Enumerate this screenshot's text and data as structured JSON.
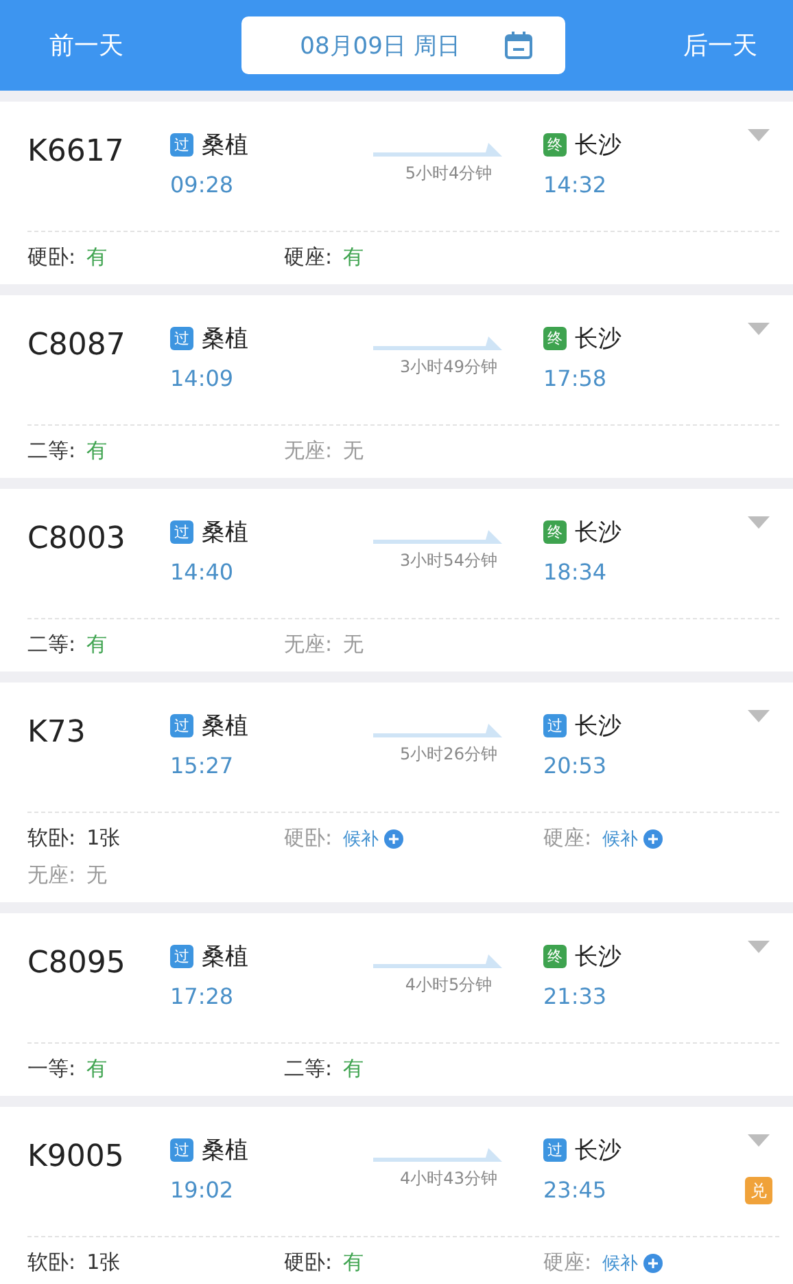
{
  "header": {
    "prev_day": "前一天",
    "date": "08月09日 周日",
    "next_day": "后一天"
  },
  "trains": [
    {
      "number": "K6617",
      "from": {
        "badge": "过",
        "kind": "pass",
        "name": "桑植",
        "time": "09:28"
      },
      "to": {
        "badge": "终",
        "kind": "end",
        "name": "长沙",
        "time": "14:32"
      },
      "duration": "5小时4分钟",
      "seats": [
        {
          "label": "硬卧:",
          "value": "有",
          "kind": "available"
        },
        {
          "label": "硬座:",
          "value": "有",
          "kind": "available"
        }
      ]
    },
    {
      "number": "C8087",
      "from": {
        "badge": "过",
        "kind": "pass",
        "name": "桑植",
        "time": "14:09"
      },
      "to": {
        "badge": "终",
        "kind": "end",
        "name": "长沙",
        "time": "17:58"
      },
      "duration": "3小时49分钟",
      "seats": [
        {
          "label": "二等:",
          "value": "有",
          "kind": "available"
        },
        {
          "label": "无座:",
          "value": "无",
          "kind": "none"
        }
      ]
    },
    {
      "number": "C8003",
      "from": {
        "badge": "过",
        "kind": "pass",
        "name": "桑植",
        "time": "14:40"
      },
      "to": {
        "badge": "终",
        "kind": "end",
        "name": "长沙",
        "time": "18:34"
      },
      "duration": "3小时54分钟",
      "seats": [
        {
          "label": "二等:",
          "value": "有",
          "kind": "available"
        },
        {
          "label": "无座:",
          "value": "无",
          "kind": "none"
        }
      ]
    },
    {
      "number": "K73",
      "from": {
        "badge": "过",
        "kind": "pass",
        "name": "桑植",
        "time": "15:27"
      },
      "to": {
        "badge": "过",
        "kind": "pass",
        "name": "长沙",
        "time": "20:53"
      },
      "duration": "5小时26分钟",
      "seats": [
        {
          "label": "软卧:",
          "value": "1张",
          "kind": "count"
        },
        {
          "label": "硬卧:",
          "value": "候补",
          "kind": "waitlist"
        },
        {
          "label": "硬座:",
          "value": "候补",
          "kind": "waitlist"
        },
        {
          "label": "无座:",
          "value": "无",
          "kind": "none"
        }
      ]
    },
    {
      "number": "C8095",
      "from": {
        "badge": "过",
        "kind": "pass",
        "name": "桑植",
        "time": "17:28"
      },
      "to": {
        "badge": "终",
        "kind": "end",
        "name": "长沙",
        "time": "21:33"
      },
      "duration": "4小时5分钟",
      "seats": [
        {
          "label": "一等:",
          "value": "有",
          "kind": "available"
        },
        {
          "label": "二等:",
          "value": "有",
          "kind": "available"
        }
      ]
    },
    {
      "number": "K9005",
      "from": {
        "badge": "过",
        "kind": "pass",
        "name": "桑植",
        "time": "19:02"
      },
      "to": {
        "badge": "过",
        "kind": "pass",
        "name": "长沙",
        "time": "23:45"
      },
      "duration": "4小时43分钟",
      "tag": "兑",
      "seats": [
        {
          "label": "软卧:",
          "value": "1张",
          "kind": "count"
        },
        {
          "label": "硬卧:",
          "value": "有",
          "kind": "available"
        },
        {
          "label": "硬座:",
          "value": "候补",
          "kind": "waitlist"
        }
      ]
    }
  ]
}
